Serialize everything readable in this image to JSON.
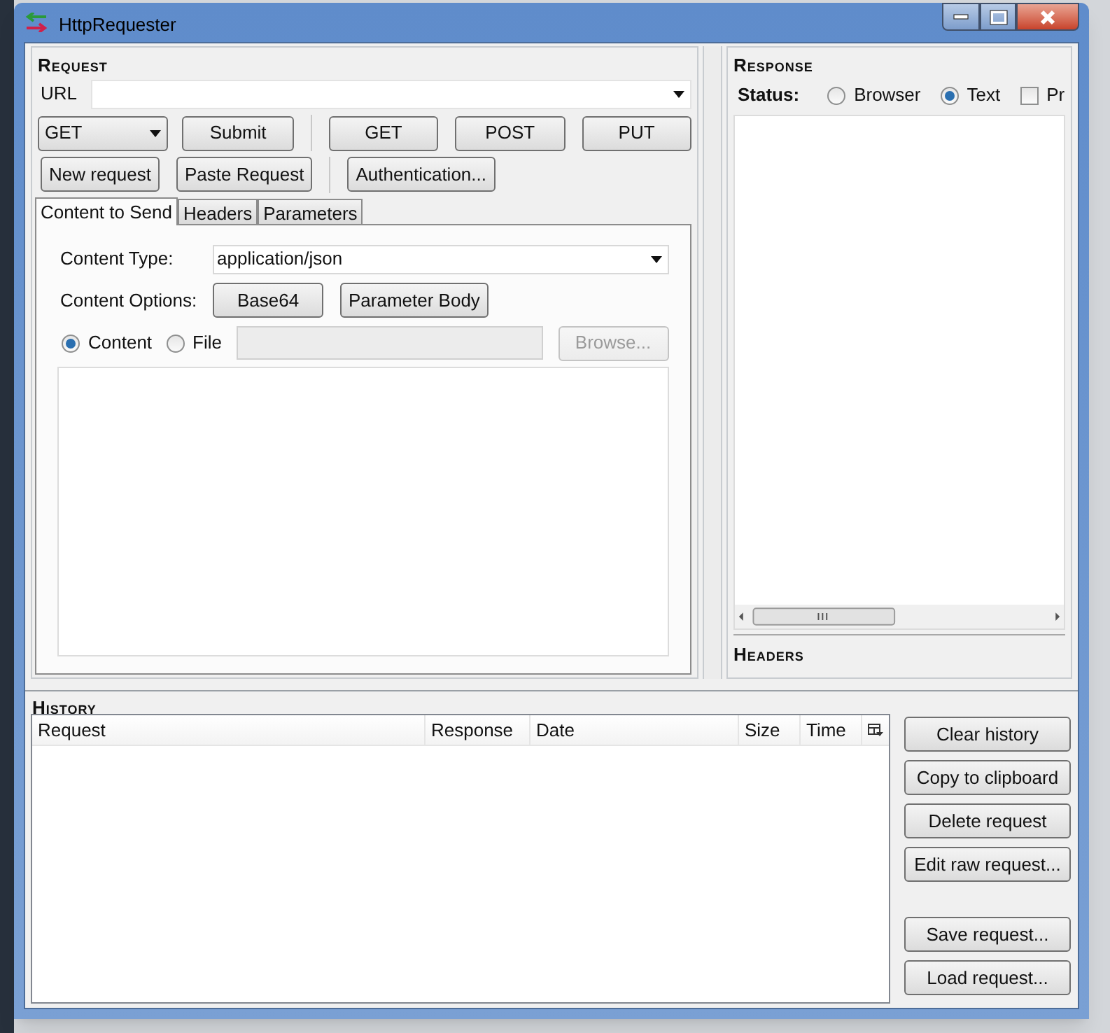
{
  "window": {
    "title": "HttpRequester"
  },
  "request": {
    "title": "Request",
    "url_label": "URL",
    "method": {
      "value": "GET"
    },
    "submit": "Submit",
    "quick_methods": [
      "GET",
      "POST",
      "PUT"
    ],
    "actions": [
      "New request",
      "Paste Request"
    ],
    "auth": "Authentication...",
    "tabs": [
      {
        "label": "Content to Send",
        "selected": true
      },
      {
        "label": "Headers",
        "selected": false
      },
      {
        "label": "Parameters",
        "selected": false
      }
    ],
    "content_type": {
      "label": "Content Type:",
      "value": "application/json"
    },
    "content_options": {
      "label": "Content Options:",
      "buttons": [
        "Base64",
        "Parameter Body"
      ]
    },
    "sources": [
      {
        "label": "Content",
        "selected": true
      },
      {
        "label": "File",
        "selected": false
      }
    ],
    "browse": {
      "label": "Browse...",
      "disabled": true
    }
  },
  "response": {
    "title": "Response",
    "status_label": "Status:",
    "views": [
      {
        "label": "Browser",
        "selected": false
      },
      {
        "label": "Text",
        "selected": true
      }
    ],
    "option": {
      "label": "Pr",
      "checked": false
    },
    "headers_title": "Headers"
  },
  "history": {
    "title": "History",
    "columns": [
      "Request",
      "Response",
      "Date",
      "Size",
      "Time"
    ],
    "buttons": [
      [
        "Clear history",
        "Copy to clipboard",
        "Delete request",
        "Edit raw request..."
      ],
      [
        "Save request...",
        "Load request..."
      ]
    ]
  }
}
